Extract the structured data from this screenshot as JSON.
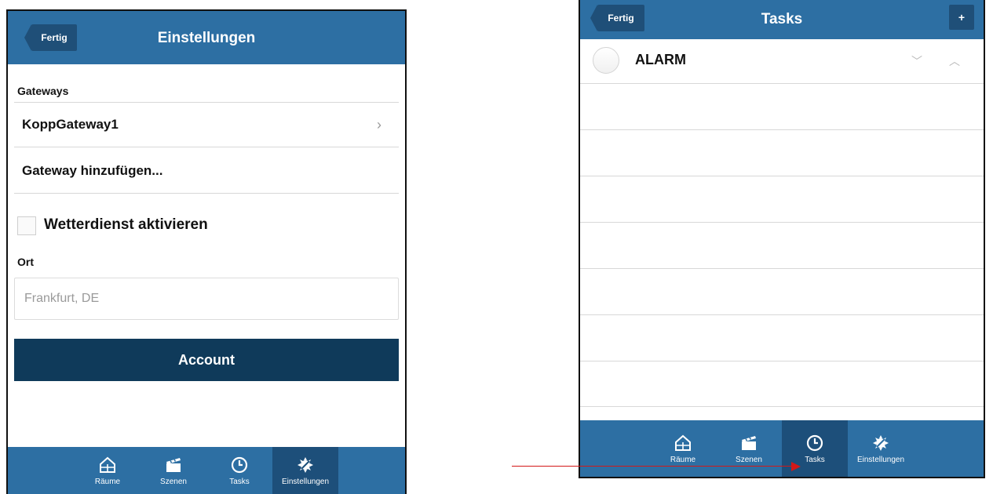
{
  "left_screen": {
    "header": {
      "back_label": "Fertig",
      "title": "Einstellungen"
    },
    "gateways_label": "Gateways",
    "gateway_item": "KoppGateway1",
    "add_gateway": "Gateway hinzufügen...",
    "weather_checkbox_label": "Wetterdienst aktivieren",
    "weather_checked": false,
    "ort_label": "Ort",
    "ort_placeholder": "Frankfurt, DE",
    "account_button": "Account",
    "tabs": [
      {
        "label": "Räume",
        "icon": "house-icon"
      },
      {
        "label": "Szenen",
        "icon": "clapperboard-icon"
      },
      {
        "label": "Tasks",
        "icon": "clock-icon"
      },
      {
        "label": "Einstellungen",
        "icon": "gear-icon"
      }
    ],
    "active_tab": "Einstellungen"
  },
  "right_screen": {
    "header": {
      "back_label": "Fertig",
      "title": "Tasks",
      "add_label": "+"
    },
    "task": {
      "label": "ALARM",
      "down_icon": "chevron-down-icon",
      "up_icon": "chevron-up-icon"
    },
    "tabs": [
      {
        "label": "Räume",
        "icon": "house-icon"
      },
      {
        "label": "Szenen",
        "icon": "clapperboard-icon"
      },
      {
        "label": "Tasks",
        "icon": "clock-icon"
      },
      {
        "label": "Einstellungen",
        "icon": "gear-icon"
      }
    ],
    "active_tab": "Tasks"
  },
  "colors": {
    "header_blue": "#2d6fa3",
    "dark_blue": "#1f4f78",
    "account_navy": "#0f3a5a",
    "annotation_red": "#d31818"
  }
}
